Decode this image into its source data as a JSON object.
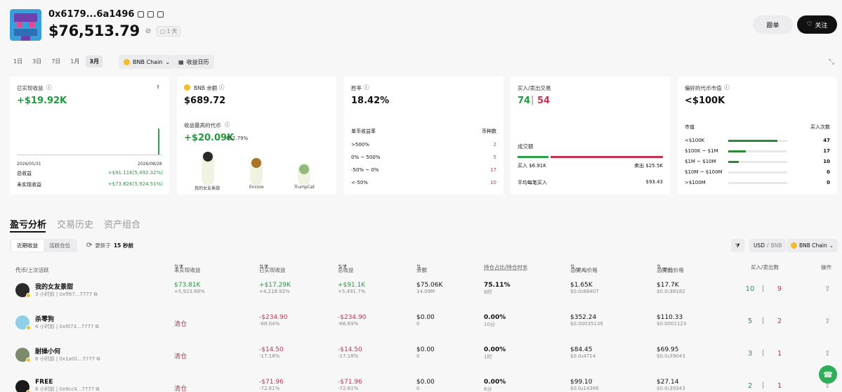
{
  "header": {
    "address": "0x6179...6a1496",
    "balance": "$76,513.79",
    "day_badge": "1 天",
    "copy_label": "跟单",
    "follow_label": "关注"
  },
  "periods": [
    "1日",
    "3日",
    "7日",
    "1月",
    "3月"
  ],
  "active_period": 4,
  "chain_label": "BNB Chain",
  "calendar_label": "收益日历",
  "card1": {
    "title": "已实现收益",
    "value": "+$19.92K",
    "date_start": "2026/05/31",
    "date_end": "2026/08/28",
    "total_label": "总收益",
    "total_value": "+$91.11K(5,492.32%)",
    "unrealized_label": "未实现收益",
    "unrealized_value": "+$73.82K(5,924.51%)"
  },
  "card2": {
    "title": "BNB 余额",
    "value": "$689.72",
    "top_label": "收益最高的代币",
    "top_value": "+$20.09K",
    "top_pct": "652.79%",
    "podium": [
      "我的女友景甜",
      "Encore",
      "TrumpCat"
    ]
  },
  "card3": {
    "title": "胜率",
    "value": "18.42%",
    "col1": "单币收益率",
    "col2": "币种数",
    "rows": [
      {
        "label": ">500%",
        "count": "2"
      },
      {
        "label": "0% ~ 500%",
        "count": "5"
      },
      {
        "label": "-50% ~ 0%",
        "count": "17"
      },
      {
        "label": "<-50%",
        "count": "10"
      }
    ]
  },
  "card4": {
    "title": "买入/卖出交易",
    "buys": "74",
    "sells": "54",
    "volume_label": "成交额",
    "buy_vol": "买入 $6.91K",
    "sell_vol": "卖出 $25.5K",
    "avg_label": "平均每笔买入",
    "avg_value": "$93.43"
  },
  "card5": {
    "title": "偏好的代币市值",
    "value": "<$100K",
    "col1": "市值",
    "col2": "买入次数",
    "rows": [
      {
        "label": "<$100K",
        "count": "47",
        "fill": 0.83
      },
      {
        "label": "$100K ~ $1M",
        "count": "17",
        "fill": 0.3
      },
      {
        "label": "$1M ~ $10M",
        "count": "10",
        "fill": 0.18
      },
      {
        "label": "$10M ~ $100M",
        "count": "0",
        "fill": 0
      },
      {
        "label": ">$100M",
        "count": "0",
        "fill": 0
      }
    ]
  },
  "tabs": [
    "盈亏分析",
    "交易历史",
    "资产组合"
  ],
  "subtabs": [
    "近期收益",
    "活跃仓位"
  ],
  "refresh_label": "更新于",
  "refresh_value": "15 秒前",
  "currency": {
    "usd": "USD",
    "sep": "/",
    "bnb": "BNB"
  },
  "table_headers": [
    "代币/上次活跃",
    "未实现收益",
    "已实现收益",
    "总收益",
    "余额",
    "持仓占比/持仓时长",
    "总买入",
    "/平均价格",
    "总卖出",
    "/平均价格",
    "买入/卖出数",
    "操作"
  ],
  "rows": [
    {
      "name": "我的女友景甜",
      "sub": "3 小时前 | 0xff67...7777",
      "unreal": "$73.81K",
      "unreal_pct": "+5,923.68%",
      "real": "+$17.29K",
      "real_pct": "+4,218.92%",
      "total": "+$91.1K",
      "total_pct": "+5,491.7%",
      "bal": "$75.06K",
      "bal_sub": "14.09M",
      "hold": "75.11%",
      "hold_sub": "6时",
      "buy": "$1.65K",
      "buy_sub": "$0.0₅88407",
      "sell": "$17.7K",
      "sell_sub": "$0.0₅38182",
      "nb": "10",
      "ns": "9",
      "color": "#2a2a2a"
    },
    {
      "name": "杀零狗",
      "sub": "4 小时前 | 0xf073...7777",
      "unreal": "清仓",
      "unreal_pct": "",
      "real": "-$234.90",
      "real_pct": "-68.04%",
      "total": "-$234.90",
      "total_pct": "-66.69%",
      "bal": "$0.00",
      "bal_sub": "0",
      "hold": "0.00%",
      "hold_sub": "10分",
      "buy": "$352.24",
      "buy_sub": "$0.00035139",
      "sell": "$110.33",
      "sell_sub": "$0.0001123",
      "nb": "5",
      "ns": "2",
      "color": "#8fd0e8"
    },
    {
      "name": "耐操小何",
      "sub": "6 小时前 | 0x1a01...7777",
      "unreal": "清仓",
      "unreal_pct": "",
      "real": "-$14.50",
      "real_pct": "-17.18%",
      "total": "-$14.50",
      "total_pct": "-17.18%",
      "bal": "$0.00",
      "bal_sub": "0",
      "hold": "0.00%",
      "hold_sub": "1时",
      "buy": "$84.45",
      "buy_sub": "$0.0₄4714",
      "sell": "$69.95",
      "sell_sub": "$0.0₄39043",
      "nb": "3",
      "ns": "1",
      "color": "#7a8a6a"
    },
    {
      "name": "FREE",
      "sub": "8 小时前 | 0x9cc4...7777",
      "unreal": "清仓",
      "unreal_pct": "",
      "real": "-$71.96",
      "real_pct": "-72.61%",
      "total": "-$71.96",
      "total_pct": "-72.61%",
      "bal": "$0.00",
      "bal_sub": "0",
      "hold": "0.00%",
      "hold_sub": "6分",
      "buy": "$99.10",
      "buy_sub": "$0.0₄14366",
      "sell": "$27.14",
      "sell_sub": "$0.0₅39343",
      "nb": "2",
      "ns": "1",
      "color": "#1a1a1a"
    }
  ]
}
